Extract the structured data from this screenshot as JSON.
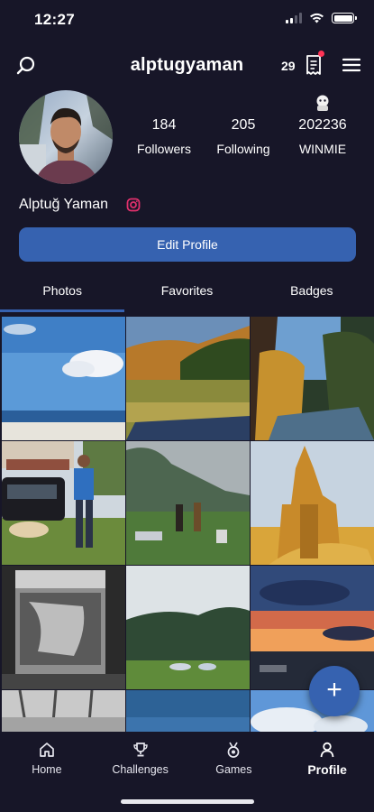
{
  "status_bar": {
    "time": "12:27",
    "icons": [
      "signal-icon",
      "wifi-icon",
      "battery-icon"
    ]
  },
  "header": {
    "username": "alptugyaman",
    "count": "29",
    "icons": [
      "search-icon",
      "receipt-icon",
      "menu-icon"
    ]
  },
  "profile": {
    "name": "Alptuğ Yaman",
    "stats": [
      {
        "value": "184",
        "label": "Followers"
      },
      {
        "value": "205",
        "label": "Following"
      },
      {
        "value": "202236",
        "label": "WINMIE"
      }
    ],
    "edit_label": "Edit Profile"
  },
  "tabs": [
    {
      "label": "Photos",
      "active": true
    },
    {
      "label": "Favorites",
      "active": false
    },
    {
      "label": "Badges",
      "active": false
    }
  ],
  "fab": {
    "label": "+"
  },
  "nav": [
    {
      "label": "Home",
      "icon": "home-icon",
      "active": false
    },
    {
      "label": "Challenges",
      "icon": "trophy-icon",
      "active": false
    },
    {
      "label": "Games",
      "icon": "medal-icon",
      "active": false
    },
    {
      "label": "Profile",
      "icon": "person-icon",
      "active": true
    }
  ],
  "colors": {
    "background": "#171628",
    "accent": "#3662b0",
    "notification": "#ff3355"
  }
}
